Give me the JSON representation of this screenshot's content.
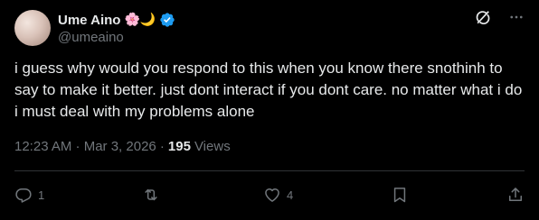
{
  "user": {
    "display_name": "Ume Aino",
    "name_emojis": "🌸🌙",
    "handle": "@umeaino"
  },
  "post": {
    "text": "i guess why would you respond to this when you know there snothinh to say to make it better. just dont interact if you dont care. no matter what i do i must deal with my problems alone",
    "timestamp": "12:23 AM · Mar 3, 2026 ·",
    "views_count": "195",
    "views_label": "Views"
  },
  "actions": {
    "replies": "1",
    "reposts": "",
    "likes": "4"
  },
  "icons": {
    "verified": "verified-badge-icon",
    "grok": "grok-icon",
    "more": "more-dots-icon",
    "reply": "reply-icon",
    "repost": "repost-icon",
    "like": "heart-icon",
    "bookmark": "bookmark-icon",
    "share": "share-icon"
  },
  "colors": {
    "background": "#000000",
    "text": "#e7e9ea",
    "secondary": "#71767b",
    "verified": "#1d9bf0",
    "divider": "#2f3336"
  }
}
